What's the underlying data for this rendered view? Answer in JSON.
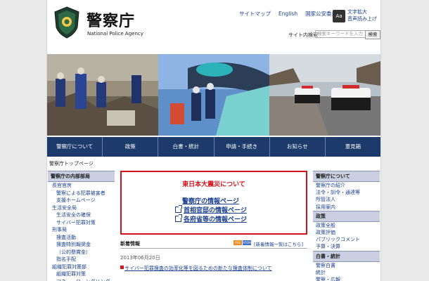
{
  "header": {
    "title": "警察庁",
    "subtitle": "National Police Agency",
    "links": [
      "サイトマップ",
      "English",
      "国家公安委員会"
    ],
    "text_size_icon": "Aa",
    "text_size_link": "文字拡大",
    "voice_link": "音声読み上げ",
    "search_label": "サイト内検索",
    "search_placeholder": "検索キーワードを入力",
    "search_button": "検索"
  },
  "nav": [
    "警察庁について",
    "政策",
    "白書・統計",
    "申請・手続き",
    "お知らせ",
    "意見箱"
  ],
  "breadcrumb": "警察庁トップページ",
  "left": {
    "heading": "警察庁の内部部局",
    "items": [
      {
        "label": "長官官房",
        "sub": false
      },
      {
        "label": "警察による犯罪被害者",
        "sub": true
      },
      {
        "label": "支援ホームページ",
        "sub": true
      },
      {
        "label": "生活安全局",
        "sub": false
      },
      {
        "label": "生活安全の確保",
        "sub": true
      },
      {
        "label": "サイバー犯罪対策",
        "sub": true
      },
      {
        "label": "刑事局",
        "sub": false
      },
      {
        "label": "捜査活動",
        "sub": true
      },
      {
        "label": "捜査特別報奨金",
        "sub": true
      },
      {
        "label": "（公的懸賞金）",
        "sub": true
      },
      {
        "label": "指名手配",
        "sub": true
      },
      {
        "label": "組織犯罪対策部",
        "sub": false
      },
      {
        "label": "組織犯罪対策",
        "sub": true
      },
      {
        "label": "マネー・ローンダリング対策",
        "sub": true
      }
    ]
  },
  "center": {
    "earthquake_title": "東日本大震災について",
    "earthquake_links": [
      "警察庁の情報ページ",
      "首相官邸の情報ページ",
      "各府省等の情報ページ"
    ],
    "news_title": "新着情報",
    "rss1": "RSS",
    "rss2": "ATOM",
    "news_list_link": "[新着情報一覧はこちら]",
    "news_date": "2013年06月20日",
    "news_item": "サイバー犯罪捜査の効率化等を図るための新たな捜査体制について"
  },
  "right": {
    "sections": [
      {
        "heading": "警察庁について",
        "items": [
          "警察庁の紹介",
          "法令・訓令・通達等",
          "所管法人",
          "採用案内"
        ]
      },
      {
        "heading": "政策",
        "items": [
          "政策全般",
          "政策評価",
          "パブリックコメント",
          "予算・決算"
        ]
      },
      {
        "heading": "白書・統計",
        "items": [
          "警察白書",
          "統計",
          "警察・広報"
        ]
      }
    ]
  },
  "colors": {
    "nav": "#1c3a6a",
    "alert": "#d3141b",
    "link": "#1a3f8f"
  }
}
